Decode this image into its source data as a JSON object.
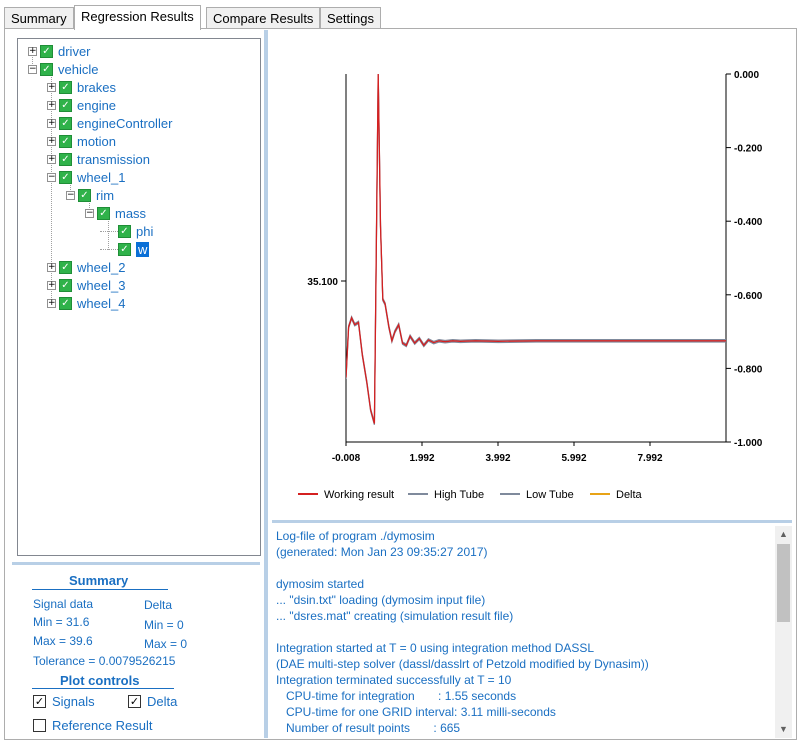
{
  "tabs": [
    "Summary",
    "Regression Results",
    "Compare Results",
    "Settings"
  ],
  "tree": [
    {
      "label": "driver",
      "expander": "+"
    },
    {
      "label": "vehicle",
      "expander": "−"
    },
    {
      "label": "brakes",
      "expander": "+"
    },
    {
      "label": "engine",
      "expander": "+"
    },
    {
      "label": "engineController",
      "expander": "+"
    },
    {
      "label": "motion",
      "expander": "+"
    },
    {
      "label": "transmission",
      "expander": "+"
    },
    {
      "label": "wheel_1",
      "expander": "−"
    },
    {
      "label": "rim",
      "expander": "−"
    },
    {
      "label": "mass",
      "expander": "−"
    },
    {
      "label": "phi",
      "expander": ""
    },
    {
      "label": "w",
      "expander": "",
      "selected": true
    },
    {
      "label": "wheel_2",
      "expander": "+"
    },
    {
      "label": "wheel_3",
      "expander": "+"
    },
    {
      "label": "wheel_4",
      "expander": "+"
    }
  ],
  "summary": {
    "title": "Summary",
    "signal_data": "Signal data",
    "delta": "Delta",
    "min": "Min = 31.6",
    "max": "Max = 39.6",
    "delta_min": "Min = 0",
    "delta_max": "Max = 0",
    "tolerance": "Tolerance = 0.0079526215"
  },
  "plot_controls": {
    "title": "Plot controls",
    "signals": "Signals",
    "signals_checked": true,
    "delta": "Delta",
    "delta_checked": true,
    "reference": "Reference Result",
    "reference_checked": false
  },
  "chart_data": {
    "type": "line",
    "title": "",
    "xlabel": "",
    "ylabel": "",
    "x_ticks": [
      "-0.008",
      "1.992",
      "3.992",
      "5.992",
      "7.992"
    ],
    "xlim": [
      -0.008,
      9.992
    ],
    "left_ticks": [
      "35.100"
    ],
    "right_ticks": [
      "0.000",
      "-0.200",
      "-0.400",
      "-0.600",
      "-0.800",
      "-1.000"
    ],
    "right_ylim": [
      -1.0,
      0.0
    ],
    "left_ylim": [
      31.6,
      39.6
    ],
    "grid": false,
    "legend_position": "bottom",
    "series": [
      {
        "name": "Working result",
        "color": "#d42020"
      },
      {
        "name": "High Tube",
        "color": "#7f8a9c"
      },
      {
        "name": "Low Tube",
        "color": "#7f8a9c"
      },
      {
        "name": "Delta",
        "color": "#e8a317"
      }
    ],
    "signal": {
      "x": [
        -0.008,
        0.06,
        0.14,
        0.22,
        0.32,
        0.42,
        0.54,
        0.64,
        0.74,
        0.84,
        0.9,
        0.96,
        1.02,
        1.12,
        1.2,
        1.28,
        1.38,
        1.48,
        1.58,
        1.68,
        1.8,
        1.92,
        2.04,
        2.16,
        2.3,
        2.44,
        2.6,
        2.8,
        3.0,
        3.4,
        4.0,
        5.0,
        6.0,
        7.0,
        8.0,
        9.0,
        9.992
      ],
      "y": [
        33.0,
        34.1,
        34.3,
        34.15,
        34.2,
        33.5,
        32.9,
        32.3,
        32.0,
        39.6,
        36.3,
        34.7,
        34.6,
        34.1,
        33.8,
        34.0,
        34.15,
        33.75,
        33.7,
        33.9,
        33.75,
        33.85,
        33.7,
        33.82,
        33.76,
        33.8,
        33.78,
        33.8,
        33.79,
        33.8,
        33.79,
        33.8,
        33.8,
        33.8,
        33.8,
        33.8,
        33.8
      ]
    }
  },
  "log": [
    "Log-file of program ./dymosim",
    "(generated: Mon Jan 23 09:35:27 2017)",
    "",
    "dymosim started",
    "... \"dsin.txt\" loading (dymosim input file)",
    "... \"dsres.mat\" creating (simulation result file)",
    "",
    "Integration started at T = 0 using integration method DASSL",
    "(DAE multi-step solver (dassl/dasslrt of Petzold modified by Dynasim))",
    "Integration terminated successfully at T = 10",
    "   CPU-time for integration       : 1.55 seconds",
    "   CPU-time for one GRID interval: 3.11 milli-seconds",
    "   Number of result points       : 665"
  ]
}
